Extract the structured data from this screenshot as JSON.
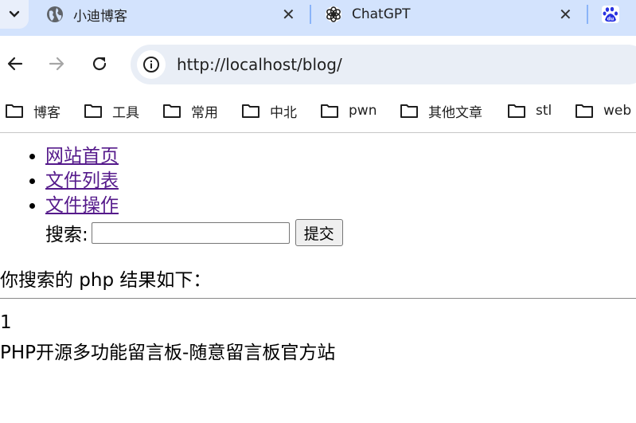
{
  "browser": {
    "tabs": [
      {
        "title": "小迪博客",
        "favicon": "globe-icon",
        "active": false
      },
      {
        "title": "ChatGPT",
        "favicon": "chatgpt-logo-icon",
        "active": false
      },
      {
        "title": "",
        "favicon": "baidu-paw-icon",
        "active": false
      }
    ],
    "close_glyph": "✕",
    "address": {
      "url": "http://localhost/blog/"
    },
    "bookmarks": [
      "博客",
      "工具",
      "常用",
      "中北",
      "pwn",
      "其他文章",
      "stl",
      "web"
    ],
    "colors": {
      "tabstrip": "#d3e3fd",
      "omnibox": "#e9eef6",
      "link_visited": "#551a8b"
    }
  },
  "page": {
    "menu": [
      "网站首页",
      "文件列表",
      "文件操作"
    ],
    "search": {
      "label": "搜索:",
      "value": "",
      "button": "提交"
    },
    "result_summary": "你搜索的 php 结果如下：",
    "results": [
      {
        "index": "1",
        "title": "PHP开源多功能留言板-随意留言板官方站"
      }
    ]
  }
}
